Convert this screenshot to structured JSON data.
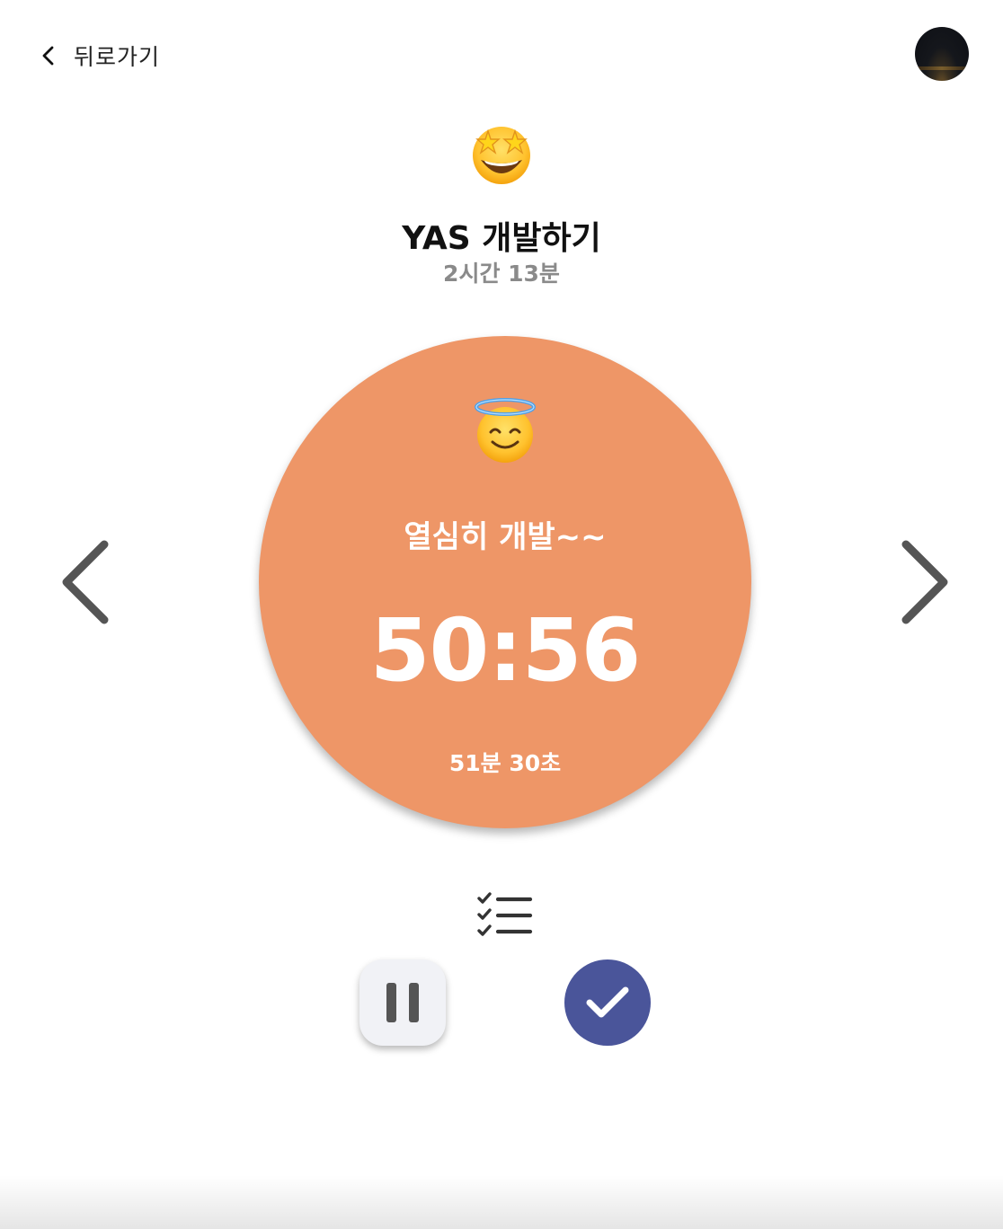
{
  "header": {
    "back_label": "뒤로가기",
    "back_icon": "chevron-left-icon",
    "avatar_icon": "profile-avatar"
  },
  "task": {
    "emoji": "star-struck-emoji",
    "title": "YAS 개발하기",
    "duration": "2시간 13분"
  },
  "timer": {
    "emoji": "smiling-face-with-halo-emoji",
    "label": "열심히 개발~~",
    "time": "50:56",
    "goal": "51분 30초",
    "color": "#ee9667"
  },
  "navigation": {
    "prev_icon": "chevron-left-icon",
    "next_icon": "chevron-right-icon"
  },
  "controls": {
    "checklist_icon": "checklist-icon",
    "pause_icon": "pause-icon",
    "complete_icon": "checkmark-icon",
    "complete_color": "#4a559a"
  }
}
